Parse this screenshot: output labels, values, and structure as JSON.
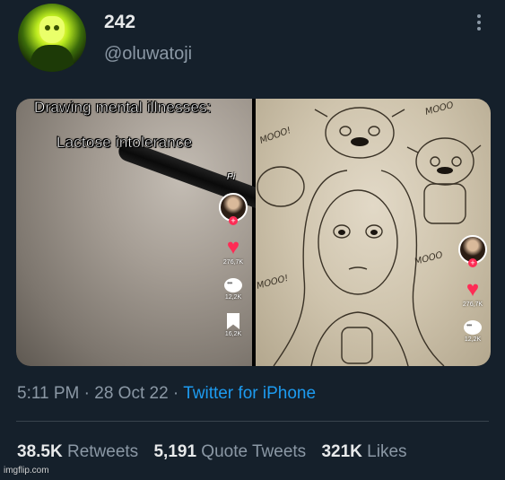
{
  "tweet": {
    "display_name": "242",
    "handle": "@oluwatoji",
    "time": "5:11 PM",
    "date": "28 Oct 22",
    "source": "Twitter for iPhone",
    "separator": "·"
  },
  "media": {
    "left": {
      "caption1": "Drawing mental illnesses:",
      "caption2": "Lactose intolerance",
      "pen_text": "Pi",
      "likes": "276,7K",
      "comments": "12,2K",
      "saves": "16,2K"
    },
    "right": {
      "sketch_text_1": "MOOO!",
      "sketch_text_2": "MOOO",
      "sketch_text_3": "MOOO",
      "sketch_text_4": "MOOO!",
      "likes": "276,7K",
      "comments": "12,2K"
    }
  },
  "stats": {
    "retweets_count": "38.5K",
    "retweets_label": "Retweets",
    "quotes_count": "5,191",
    "quotes_label": "Quote Tweets",
    "likes_count": "321K",
    "likes_label": "Likes"
  },
  "watermark": "imgflip.com",
  "icons": [
    "more-icon",
    "heart-icon",
    "comment-icon",
    "bookmark-icon",
    "share-icon",
    "follow-plus-icon"
  ],
  "colors": {
    "background": "#15202b",
    "link": "#1d9bf0",
    "muted": "#8b98a5",
    "tiktok_red": "#fe2c55"
  }
}
